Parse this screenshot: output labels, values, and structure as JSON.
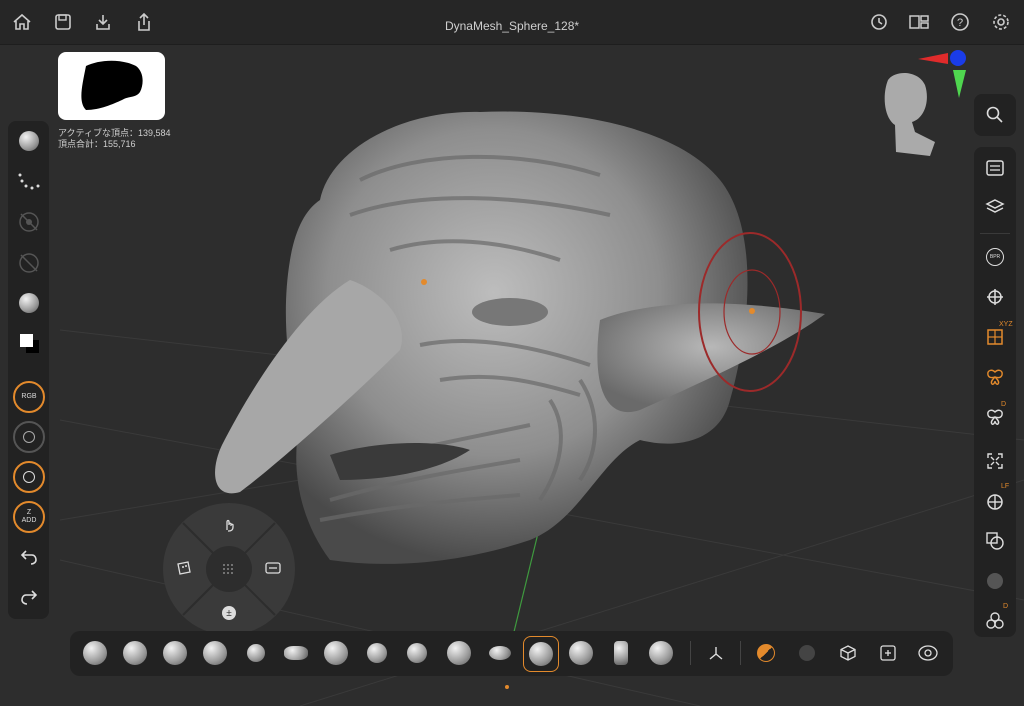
{
  "app": {
    "document_title": "DynaMesh_Sphere_128*"
  },
  "stats": {
    "active_vertices": "アクティブな頂点：139,584",
    "total_vertices": "頂点合計：155,716"
  },
  "leftbar": {
    "rgb_label": "RGB",
    "z_label": "Z",
    "add_label": "ADD"
  },
  "rightbar": {
    "xyz_label": "XYZ",
    "d_label": "D",
    "lf_label": "LF",
    "d2_label": "D"
  },
  "colors": {
    "accent": "#e38a2c",
    "panel": "#222222",
    "viewport": "#2d2d2d"
  },
  "icons": {
    "top": [
      "home-icon",
      "save-icon",
      "import-icon",
      "share-icon",
      "history-icon",
      "layout-icon",
      "help-icon",
      "settings-icon"
    ],
    "left": [
      "brush-icon",
      "stroke-icon",
      "alpha-off-icon",
      "texture-off-icon",
      "material-icon",
      "color-swatch-icon",
      "rgb-icon",
      "draw-size-icon",
      "focal-shift-icon",
      "z-add-icon",
      "undo-icon",
      "redo-icon"
    ],
    "right": [
      "search-icon",
      "menu-icon",
      "layers-icon",
      "bpr-icon",
      "move-icon",
      "xyz-icon",
      "symmetry-icon",
      "mirror-icon",
      "frame-icon",
      "perspective-icon",
      "transparency-icon",
      "ghost-icon",
      "subtool-icon"
    ]
  }
}
